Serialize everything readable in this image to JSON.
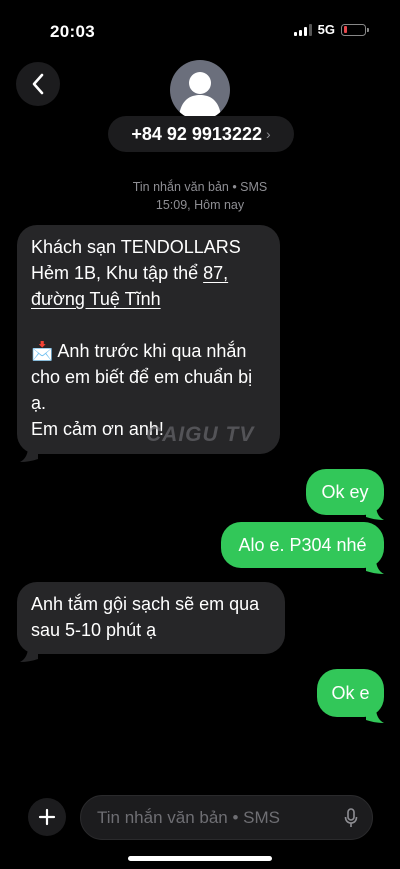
{
  "status_bar": {
    "time": "20:03",
    "network": "5G"
  },
  "header": {
    "contact_number": "+84 92 9913222",
    "chevron": "›"
  },
  "thread": {
    "service_label": "Tin nhắn văn bản • SMS",
    "timestamp": "15:09, Hôm nay"
  },
  "messages": [
    {
      "direction": "incoming",
      "line1": "Khách sạn TENDOLLARS",
      "line2_prefix": "Hẻm 1B, Khu tập thể ",
      "line2_link": "87,",
      "line3_link": "đường Tuệ Tĩnh",
      "line4_emoji": "📩",
      "line4_text": " Anh trước khi qua nhắn",
      "line5": "cho em biết để em chuẩn bị",
      "line6": "ạ.",
      "line7": "Em cảm ơn anh!"
    },
    {
      "direction": "outgoing",
      "text": "Ok ey"
    },
    {
      "direction": "outgoing",
      "text": "Alo e. P304 nhé"
    },
    {
      "direction": "incoming",
      "line1": "Anh tắm gội sạch sẽ em qua",
      "line2": "sau 5-10 phút ạ"
    },
    {
      "direction": "outgoing",
      "text": "Ok e"
    }
  ],
  "watermark": "CAIGU TV",
  "composer": {
    "placeholder": "Tin nhắn văn bản • SMS"
  },
  "colors": {
    "outgoing_bubble": "#32c759",
    "incoming_bubble": "#262628",
    "background": "#000000"
  },
  "icons": {
    "back": "chevron-left-icon",
    "avatar": "person-icon",
    "add": "plus-icon",
    "mic": "microphone-icon"
  }
}
